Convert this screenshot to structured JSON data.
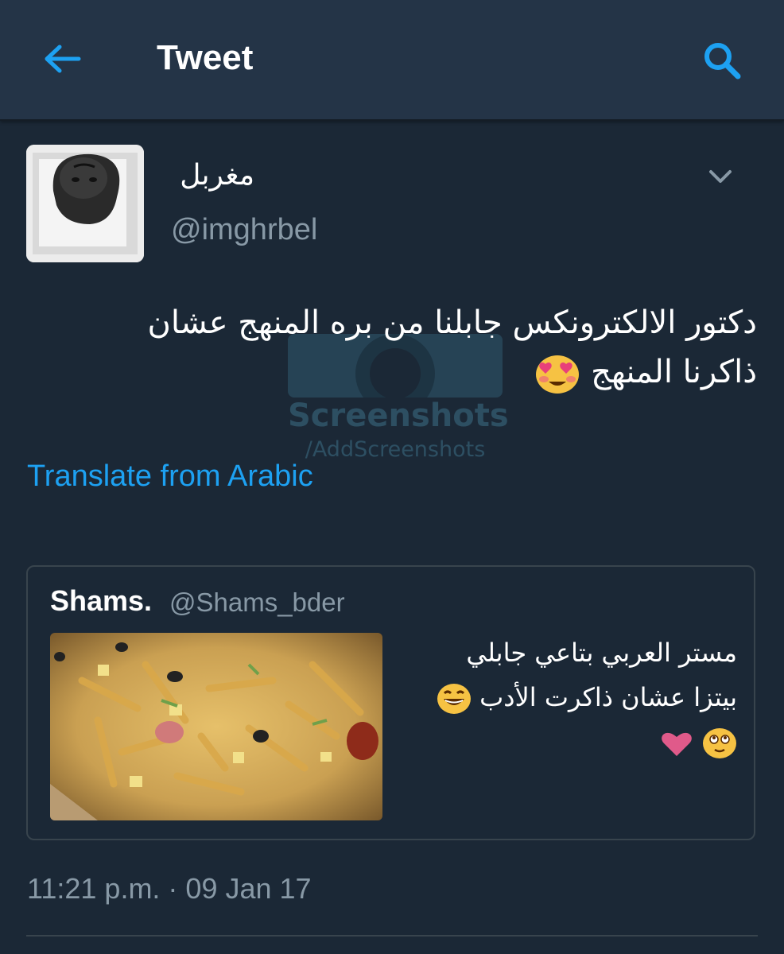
{
  "header": {
    "title": "Tweet",
    "back_icon": "back-arrow-icon",
    "search_icon": "search-icon",
    "accent_color": "#1da1f2",
    "background": "#243447"
  },
  "tweet": {
    "display_name": "مغربل",
    "handle": "@imghrbel",
    "text_line1": "دكتور الالكترونكس جابلنا من بره المنهج عشان",
    "text_line2": "ذاكرنا المنهج",
    "emoji": "heart-eyes-emoji",
    "translate_label": "Translate from Arabic",
    "timestamp": "11:21 p.m. · 09 Jan 17"
  },
  "quoted_tweet": {
    "display_name": "Shams.",
    "handle": "@Shams_bder",
    "text_line1": "مستر العربي بتاعي جابلي",
    "text_line2": "بيتزا عشان ذاكرت الأدب",
    "emojis": [
      "laughing-emoji",
      "blushing-emoji",
      "heart-emoji"
    ],
    "image": "pizza-photo"
  },
  "watermark": {
    "line1": "Screenshots",
    "line2": "/AddScreenshots"
  }
}
